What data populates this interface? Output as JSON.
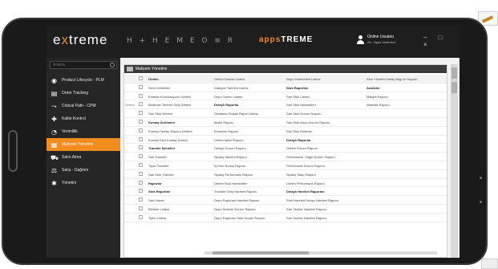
{
  "app": {
    "logo_text_left": "e",
    "logo_text_x": "x",
    "logo_text_right": "treme",
    "toolbar_icons": "H + H E M E O ≡ R",
    "brand_left": "apps",
    "brand_right": "TREME",
    "user_name": "Online Usuário",
    "user_role": "Att - Apps treatment",
    "window_controls": "– □ ×"
  },
  "sidebar": {
    "search_placeholder": "Arama",
    "items": [
      {
        "label": "Product Lifecycle - PLM",
        "icon": "lifecycle-icon",
        "active": false
      },
      {
        "label": "Order Tracking",
        "icon": "order-icon",
        "active": false
      },
      {
        "label": "Critical Path - CPM",
        "icon": "path-icon",
        "active": false
      },
      {
        "label": "Kalite Kontrol",
        "icon": "quality-icon",
        "active": false
      },
      {
        "label": "Verimlilik",
        "icon": "efficiency-icon",
        "active": false
      },
      {
        "label": "Maliyeto Yönetimi",
        "icon": "cost-icon",
        "active": true
      },
      {
        "label": "Satın Alma",
        "icon": "cart-icon",
        "active": false
      },
      {
        "label": "Satış - Dağıtım",
        "icon": "sales-icon",
        "active": false
      },
      {
        "label": "Yönetim",
        "icon": "settings-icon",
        "active": false
      }
    ]
  },
  "panel": {
    "title": "Maliyeto Yönetimi"
  },
  "grid": {
    "rows": [
      {
        "c0": "",
        "c2": "Üretim",
        "c3": "Üretim Fazlası Listesi",
        "c4": "Depo Hareketleri Listesi",
        "c5": "Stok Yönetim Detay Bilgi ve Raporu",
        "bold2": true
      },
      {
        "c0": "",
        "c2": "Sevir Üretimleri",
        "c3": "Kategori Tarihleri Listesi",
        "c4": "Stok Raporları",
        "c5": "Analizler",
        "bold4": true,
        "bold5": true
      },
      {
        "c0": "",
        "c2": "Emtelar Kümülasyonu Üretimi",
        "c3": "Depo Tanımı Listesi",
        "c4": "Sari Stok Listesi",
        "c5": "Maliyet Raporu"
      },
      {
        "c0": "Üretim",
        "c2": "Bedenler Tarihler Giriş Üretimi",
        "c3": "Detaylı Raporlar",
        "c4": "Sari Stok Hareketleri",
        "c5": "İstatistik Raporu",
        "bold3": true
      },
      {
        "c0": "",
        "c2": "Sari Stok Üretimi",
        "c3": "Ortalama Stoklar Rapor Listesi",
        "c4": "Sari Stok Durum Raporu",
        "c5": ""
      },
      {
        "c0": "",
        "c2": "Kumaş Üretimleri",
        "c3": "Bedel Raporu",
        "c4": "Sari Stok Depo Durum Raporu",
        "c5": "",
        "bold2": true
      },
      {
        "c0": "",
        "c2": "Kumaş Fazlası Raporu Üretimi",
        "c3": "Envanter Raporu",
        "c4": "Sari Stok Ekstresi",
        "c5": ""
      },
      {
        "c0": "",
        "c2": "Kumaş Ölçü Kumaş Üretimi",
        "c3": "Üretim İşlem Raporu",
        "c4": "Detaylı Raporlar",
        "c5": "",
        "bold4": true
      },
      {
        "c0": "",
        "c2": "Transfer İşlemleri",
        "c3": "Detaylı Durum Raporu",
        "c4": "Üretim Durum Raporu",
        "c5": "",
        "bold2": true
      },
      {
        "c0": "",
        "c2": "Sari Transfer",
        "c3": "Sipariş Takvimi Raporu",
        "c4": "Performans - Bağıl Durum Raporu",
        "c5": ""
      },
      {
        "c0": "",
        "c2": "Toplu Transfer",
        "c3": "İş Emri Sonuç Raporu",
        "c4": "Performans Durum Raporu",
        "c5": ""
      },
      {
        "c0": "",
        "c2": "Sari Stok Transfer",
        "c3": "Sipariş Performans Raporu",
        "c4": "Sipariş Takip Raporu",
        "c5": ""
      },
      {
        "c0": "",
        "c2": "Raporlar",
        "c3": "Üretim Stok Hareketleri",
        "c4": "Üretim Performans Raporu",
        "c5": "",
        "bold2": true
      },
      {
        "c0": "",
        "c2": "Stok Raporları",
        "c3": "Transfer Giriş Hareket Raporu",
        "c4": "Detaylı Hareket Raporları",
        "c5": "",
        "bold2": true,
        "bold4": true
      },
      {
        "c0": "",
        "c2": "Sari Listesi",
        "c3": "Depo Raporları Hareket Raporu",
        "c4": "Stok Hareket Detayı Hareket Raporu",
        "c5": ""
      },
      {
        "c0": "",
        "c2": "Birimler Listesi",
        "c3": "Depo Stokları Durum Raporu",
        "c4": "Sari Stoklar Hareket Raporu",
        "c5": ""
      },
      {
        "c0": "",
        "c2": "Tipler Listesi",
        "c3": "Depo Raporları Stok Durum Raporu",
        "c4": "Sari Stoklar Hareket Raporu",
        "c5": ""
      }
    ]
  },
  "colors": {
    "accent": "#f28c1e",
    "topbar": "#1e1e1e",
    "sidebar": "#262626"
  }
}
